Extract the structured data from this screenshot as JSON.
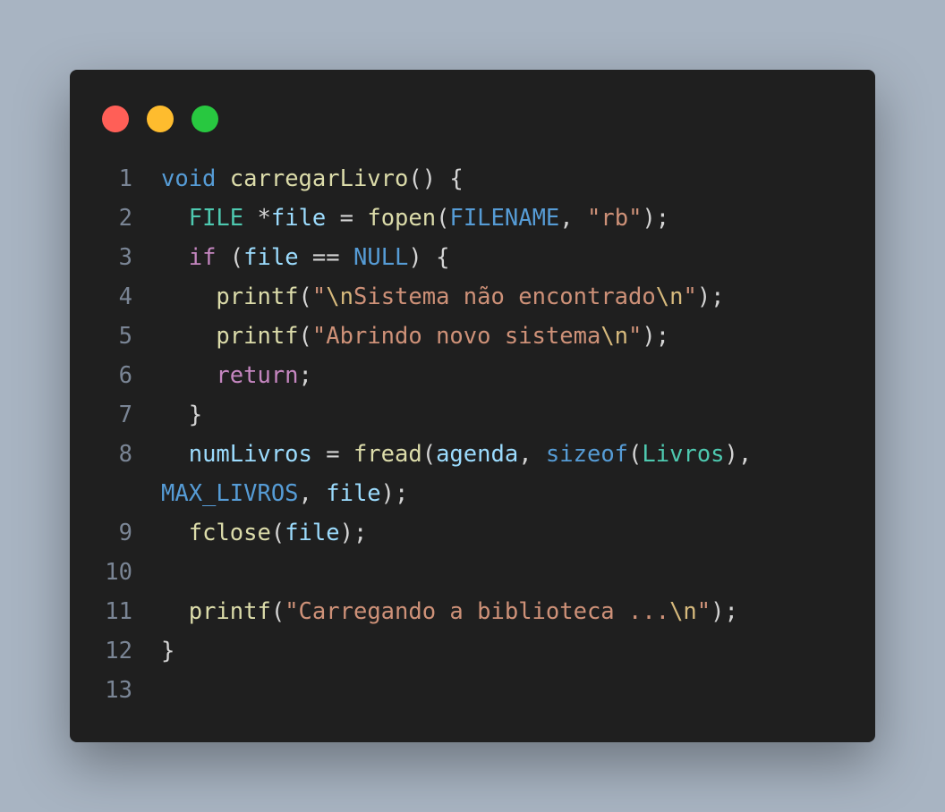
{
  "window": {
    "controls": [
      {
        "name": "close",
        "color": "#ff5f57"
      },
      {
        "name": "minimize",
        "color": "#febc2e"
      },
      {
        "name": "maximize",
        "color": "#28c840"
      }
    ]
  },
  "code": {
    "language": "c",
    "line_numbers": [
      "1",
      "2",
      "3",
      "4",
      "5",
      "6",
      "7",
      "8",
      "",
      "9",
      "10",
      "11",
      "12",
      "13"
    ],
    "lines": [
      [
        [
          "void",
          "type"
        ],
        [
          " ",
          "punc"
        ],
        [
          "carregarLivro",
          "fn"
        ],
        [
          "() {",
          "punc"
        ]
      ],
      [
        [
          "  ",
          "punc"
        ],
        [
          "FILE",
          "class"
        ],
        [
          " *",
          "punc"
        ],
        [
          "file",
          "var"
        ],
        [
          " = ",
          "punc"
        ],
        [
          "fopen",
          "fn"
        ],
        [
          "(",
          "punc"
        ],
        [
          "FILENAME",
          "const"
        ],
        [
          ", ",
          "punc"
        ],
        [
          "\"rb\"",
          "str"
        ],
        [
          ");",
          "punc"
        ]
      ],
      [
        [
          "  ",
          "punc"
        ],
        [
          "if",
          "ctrl"
        ],
        [
          " (",
          "punc"
        ],
        [
          "file",
          "var"
        ],
        [
          " == ",
          "punc"
        ],
        [
          "NULL",
          "const"
        ],
        [
          ") {",
          "punc"
        ]
      ],
      [
        [
          "    ",
          "punc"
        ],
        [
          "printf",
          "fn"
        ],
        [
          "(",
          "punc"
        ],
        [
          "\"",
          "str"
        ],
        [
          "\\n",
          "esc"
        ],
        [
          "Sistema não encontrado",
          "str"
        ],
        [
          "\\n",
          "esc"
        ],
        [
          "\"",
          "str"
        ],
        [
          ");",
          "punc"
        ]
      ],
      [
        [
          "    ",
          "punc"
        ],
        [
          "printf",
          "fn"
        ],
        [
          "(",
          "punc"
        ],
        [
          "\"Abrindo novo sistema",
          "str"
        ],
        [
          "\\n",
          "esc"
        ],
        [
          "\"",
          "str"
        ],
        [
          ");",
          "punc"
        ]
      ],
      [
        [
          "    ",
          "punc"
        ],
        [
          "return",
          "ctrl"
        ],
        [
          ";",
          "punc"
        ]
      ],
      [
        [
          "  }",
          "punc"
        ]
      ],
      [
        [
          "  ",
          "punc"
        ],
        [
          "numLivros",
          "var"
        ],
        [
          " = ",
          "punc"
        ],
        [
          "fread",
          "fn"
        ],
        [
          "(",
          "punc"
        ],
        [
          "agenda",
          "var"
        ],
        [
          ", ",
          "punc"
        ],
        [
          "sizeof",
          "type"
        ],
        [
          "(",
          "punc"
        ],
        [
          "Livros",
          "class"
        ],
        [
          "),",
          "punc"
        ]
      ],
      [
        [
          "MAX_LIVROS",
          "const"
        ],
        [
          ", ",
          "punc"
        ],
        [
          "file",
          "var"
        ],
        [
          ");",
          "punc"
        ]
      ],
      [
        [
          "  ",
          "punc"
        ],
        [
          "fclose",
          "fn"
        ],
        [
          "(",
          "punc"
        ],
        [
          "file",
          "var"
        ],
        [
          ");",
          "punc"
        ]
      ],
      [],
      [
        [
          "  ",
          "punc"
        ],
        [
          "printf",
          "fn"
        ],
        [
          "(",
          "punc"
        ],
        [
          "\"Carregando a biblioteca ...",
          "str"
        ],
        [
          "\\n",
          "esc"
        ],
        [
          "\"",
          "str"
        ],
        [
          ");",
          "punc"
        ]
      ],
      [
        [
          "}",
          "punc"
        ]
      ],
      []
    ]
  }
}
